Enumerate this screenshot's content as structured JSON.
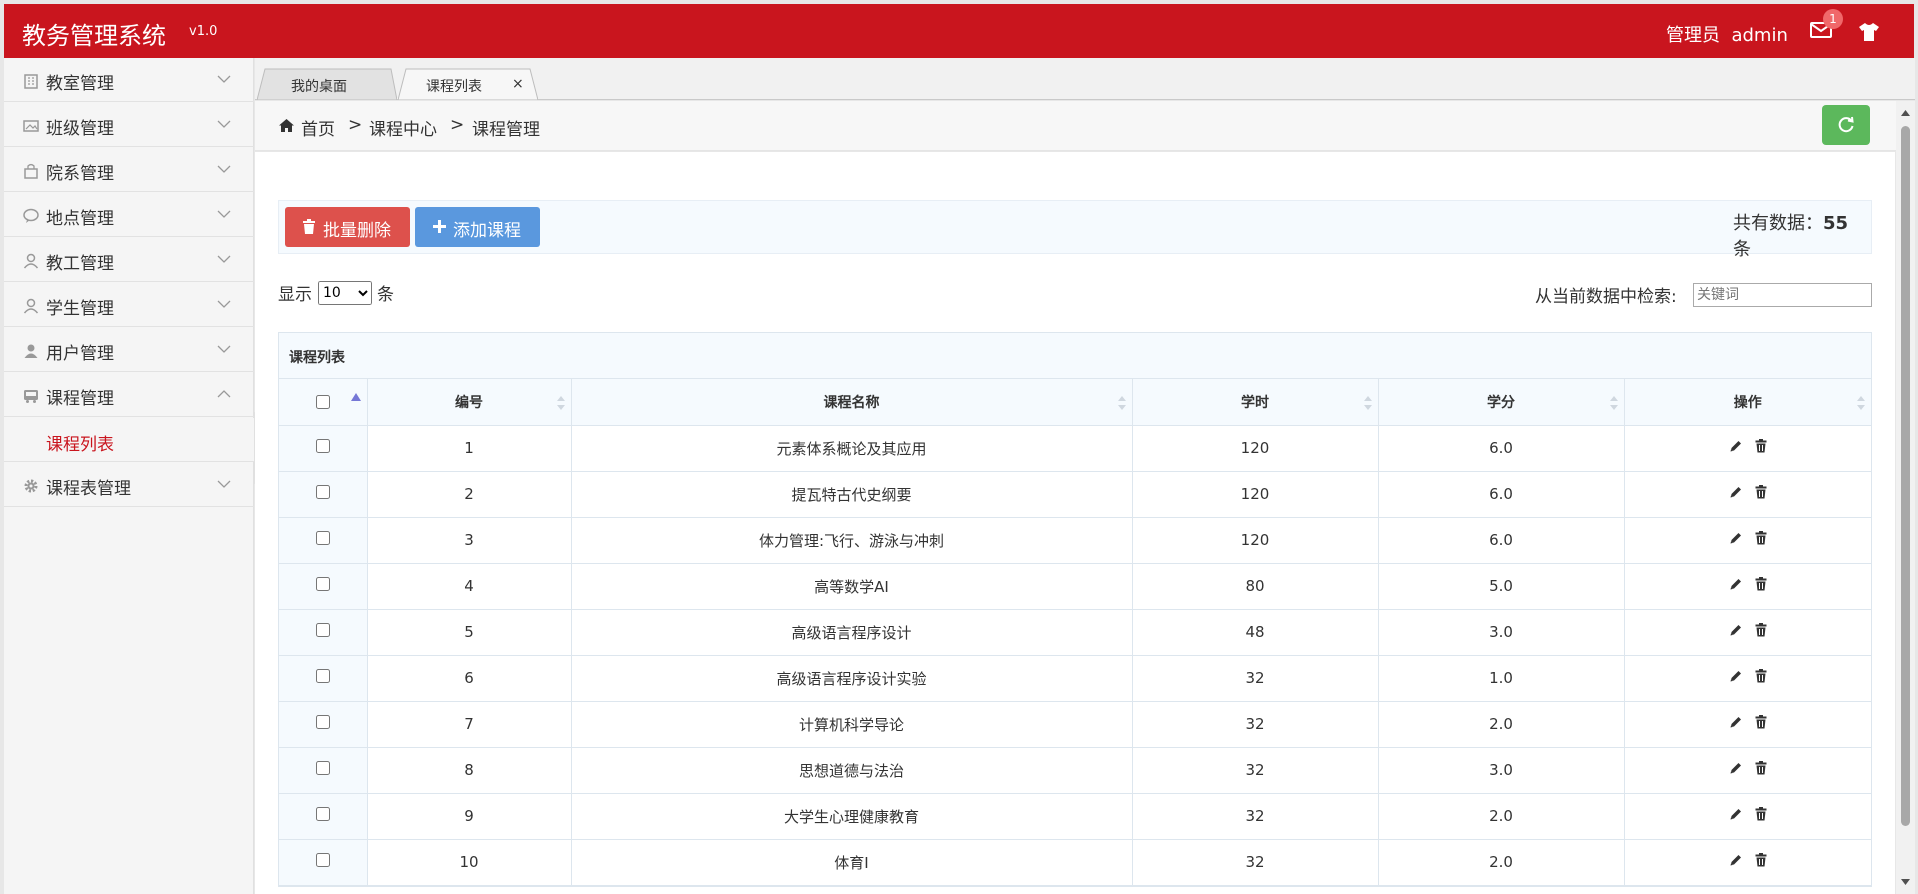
{
  "header": {
    "title": "教务管理系统",
    "version": "v1.0",
    "user_role": "管理员",
    "username": "admin",
    "mail_badge": "1",
    "brand_color": "#c9151e"
  },
  "sidebar": {
    "items": [
      {
        "label": "教室管理",
        "icon": "building-icon"
      },
      {
        "label": "班级管理",
        "icon": "image-icon"
      },
      {
        "label": "院系管理",
        "icon": "bag-icon"
      },
      {
        "label": "地点管理",
        "icon": "chat-icon"
      },
      {
        "label": "教工管理",
        "icon": "user-icon"
      },
      {
        "label": "学生管理",
        "icon": "user-icon"
      },
      {
        "label": "用户管理",
        "icon": "user-filled-icon"
      },
      {
        "label": "课程管理",
        "icon": "bus-icon",
        "expanded": true
      },
      {
        "label": "课程表管理",
        "icon": "gear-icon"
      }
    ],
    "subitems": [
      {
        "label": "课程列表",
        "active": true
      }
    ]
  },
  "tabs": [
    {
      "label": "我的桌面"
    },
    {
      "label": "课程列表",
      "active": true,
      "closable": true
    }
  ],
  "tab_close_glyph": "×",
  "breadcrumb": {
    "home": "首页",
    "sep": ">",
    "level1": "课程中心",
    "level2": "课程管理"
  },
  "toolbar": {
    "batch_delete": "批量删除",
    "add_course": "添加课程",
    "total_prefix": "共有数据：",
    "total_count": "55",
    "total_suffix": "条"
  },
  "list_controls": {
    "show_prefix": "显示",
    "page_size": "10",
    "show_suffix": "条",
    "search_label": "从当前数据中检索:",
    "search_placeholder": "关键词"
  },
  "table": {
    "caption": "课程列表",
    "columns": [
      "编号",
      "课程名称",
      "学时",
      "学分",
      "操作"
    ],
    "rows": [
      {
        "id": "1",
        "name": "元素体系概论及其应用",
        "hours": "120",
        "credits": "6.0"
      },
      {
        "id": "2",
        "name": "提瓦特古代史纲要",
        "hours": "120",
        "credits": "6.0"
      },
      {
        "id": "3",
        "name": "体力管理:飞行、游泳与冲刺",
        "hours": "120",
        "credits": "6.0"
      },
      {
        "id": "4",
        "name": "高等数学AI",
        "hours": "80",
        "credits": "5.0"
      },
      {
        "id": "5",
        "name": "高级语言程序设计",
        "hours": "48",
        "credits": "3.0"
      },
      {
        "id": "6",
        "name": "高级语言程序设计实验",
        "hours": "32",
        "credits": "1.0"
      },
      {
        "id": "7",
        "name": "计算机科学导论",
        "hours": "32",
        "credits": "2.0"
      },
      {
        "id": "8",
        "name": "思想道德与法治",
        "hours": "32",
        "credits": "3.0"
      },
      {
        "id": "9",
        "name": "大学生心理健康教育",
        "hours": "32",
        "credits": "2.0"
      },
      {
        "id": "10",
        "name": "体育I",
        "hours": "32",
        "credits": "2.0"
      }
    ]
  },
  "colors": {
    "danger": "#dd514c",
    "primary": "#5a98de",
    "success": "#5cb85c"
  }
}
